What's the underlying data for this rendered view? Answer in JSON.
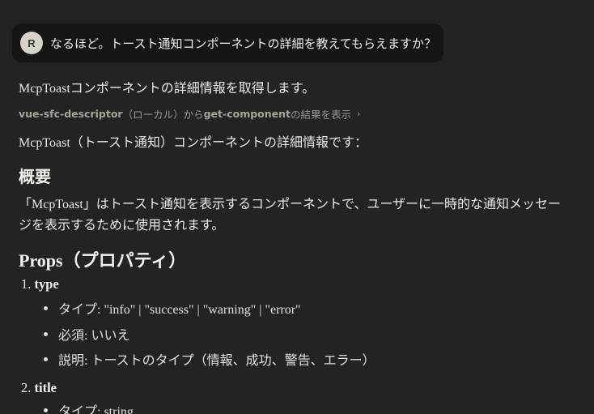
{
  "user_message": {
    "avatar_initial": "R",
    "text": "なるほど。トースト通知コンポーネントの詳細を教えてもらえますか？"
  },
  "response": {
    "intro": "McpToastコンポーネントの詳細情報を取得します。",
    "tool_call": {
      "source": "vue-sfc-descriptor",
      "middle": "（ローカル）から",
      "tool": "get-component",
      "suffix": "の結果を表示",
      "chevron": "›"
    },
    "summary": "McpToast（トースト通知）コンポーネントの詳細情報です：",
    "overview_heading": "概要",
    "overview_line1": "「McpToast」はトースト通知を表示するコンポーネントで、ユーザーに一時的な通知メッセー",
    "overview_line2": "ジを表示するために使用されます。",
    "props_heading": "Props（プロパティ）",
    "props": [
      {
        "number": "1.",
        "name": "type",
        "details": [
          "タイプ: \"info\" | \"success\" | \"warning\" | \"error\"",
          "必須: いいえ",
          "説明: トーストのタイプ（情報、成功、警告、エラー）"
        ]
      },
      {
        "number": "2.",
        "name": "title",
        "details": [
          "タイプ: string"
        ]
      }
    ]
  }
}
